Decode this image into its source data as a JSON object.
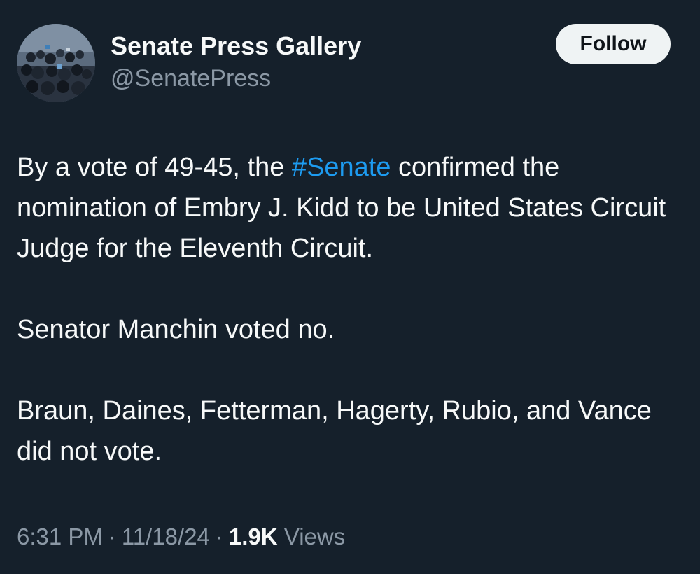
{
  "author": {
    "display_name": "Senate Press Gallery",
    "handle": "@SenatePress",
    "avatar_icon": "crowd-photo-avatar"
  },
  "follow_button": {
    "label": "Follow"
  },
  "tweet": {
    "p1_before": "By a vote of 49-45, the ",
    "p1_hashtag": "#Senate",
    "p1_after": " confirmed the nomination of Embry J. Kidd to be United States Circuit Judge for the Eleventh Circuit.",
    "p2": "Senator Manchin voted no.",
    "p3": "Braun, Daines, Fetterman, Hagerty, Rubio, and Vance did not vote."
  },
  "meta": {
    "time": "6:31 PM",
    "date": "11/18/24",
    "views_count": "1.9K",
    "views_label": "Views",
    "separator": "·"
  },
  "colors": {
    "background": "#15202b",
    "hashtag": "#1d9bf0",
    "secondary_text": "#8b98a5"
  }
}
